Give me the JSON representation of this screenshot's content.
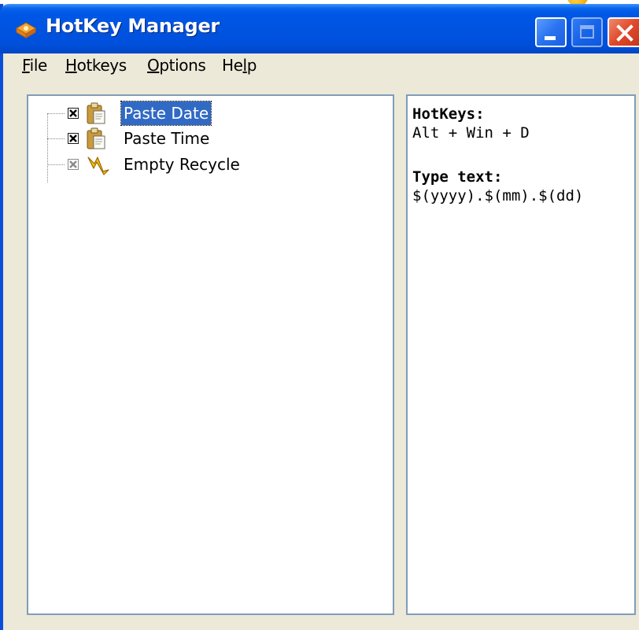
{
  "window": {
    "title": "HotKey Manager"
  },
  "menu": {
    "items": [
      {
        "label": "File"
      },
      {
        "label": "Hotkeys"
      },
      {
        "label": "Options"
      },
      {
        "label": "Help"
      }
    ]
  },
  "tree": {
    "nodes": [
      {
        "label": "Paste Date",
        "checked": true,
        "selected": true,
        "icon": "clipboard-icon"
      },
      {
        "label": "Paste Time",
        "checked": true,
        "selected": false,
        "icon": "clipboard-icon"
      },
      {
        "label": "Empty Recycle",
        "checked": true,
        "selected": false,
        "icon": "lightning-icon",
        "disabled": true
      }
    ]
  },
  "details": {
    "hotkeys_heading": "HotKeys:",
    "hotkeys_value": "Alt + Win + D",
    "type_text_heading": "Type text:",
    "type_text_value": "$(yyyy).$(mm).$(dd)"
  },
  "colors": {
    "titlebar": "#0053e1",
    "selection": "#316ac5",
    "panel_border": "#7f9db9",
    "window_face": "#ece9d8"
  }
}
